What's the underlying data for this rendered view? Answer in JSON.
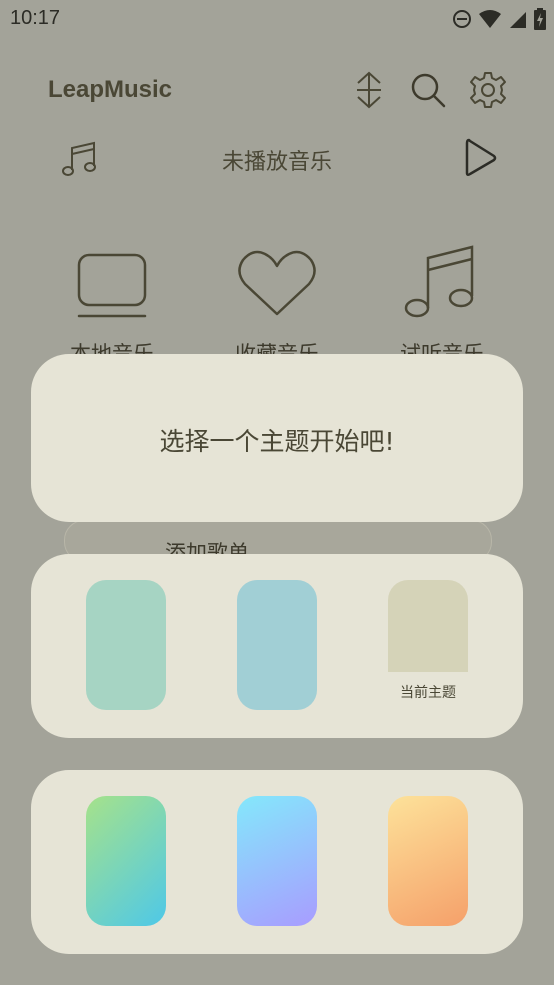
{
  "status_bar": {
    "time": "10:17",
    "icons": [
      "do-not-disturb-icon",
      "wifi-icon",
      "signal-icon",
      "battery-charging-icon"
    ]
  },
  "header": {
    "app_title": "LeapMusic",
    "icons": [
      "sort-icon",
      "search-icon",
      "settings-icon"
    ]
  },
  "now_playing": {
    "text": "未播放音乐",
    "icons": [
      "music-note-icon",
      "play-icon"
    ]
  },
  "shortcuts": [
    {
      "label": "本地音乐",
      "icon": "monitor-icon"
    },
    {
      "label": "收藏音乐",
      "icon": "heart-icon"
    },
    {
      "label": "试听音乐",
      "icon": "music-notes-icon"
    }
  ],
  "underlay": {
    "add_playlist_label": "添加歌单"
  },
  "theme_dialog": {
    "prompt": "选择一个主题开始吧!"
  },
  "theme_panels": {
    "solid": {
      "swatches": [
        {
          "color": "#a6d4c3"
        },
        {
          "color": "#a1cfd5"
        },
        {
          "color": "#d5d3b8",
          "label": "当前主题",
          "current": true
        }
      ]
    },
    "gradient": {
      "swatches": [
        {
          "from": "#a6e28a",
          "to": "#4ec8e8"
        },
        {
          "from": "#84e8fb",
          "to": "#a89cff"
        },
        {
          "from": "#fde29a",
          "to": "#f5a06a"
        }
      ]
    }
  },
  "colors": {
    "background": "#a3a399",
    "panel": "#e6e4d6",
    "text": "#4a4735"
  }
}
